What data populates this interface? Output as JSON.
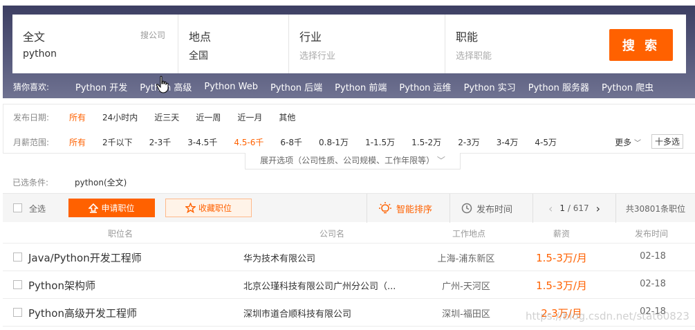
{
  "search": {
    "fields": [
      {
        "title": "全文",
        "value": "python",
        "hint": "搜公司"
      },
      {
        "title": "地点",
        "value": "全国"
      },
      {
        "title": "行业",
        "placeholder": "选择行业"
      },
      {
        "title": "职能",
        "placeholder": "选择职能"
      }
    ],
    "button_label": "搜 索",
    "guess_label": "猜你喜欢:",
    "guess_items": [
      "Python 开发",
      "Python 高级",
      "Python Web",
      "Python 后端",
      "Python 前端",
      "Python 运维",
      "Python 实习",
      "Python 服务器",
      "Python 爬虫"
    ]
  },
  "filters": {
    "date": {
      "label": "发布日期:",
      "options": [
        "所有",
        "24小时内",
        "近三天",
        "近一周",
        "近一月",
        "其他"
      ],
      "active": 0
    },
    "salary": {
      "label": "月薪范围:",
      "options": [
        "所有",
        "2千以下",
        "2-3千",
        "3-4.5千",
        "4.5-6千",
        "6-8千",
        "0.8-1万",
        "1-1.5万",
        "1.5-2万",
        "2-3万",
        "3-4万",
        "4-5万"
      ],
      "active": [
        0,
        4
      ]
    },
    "more_label": "更多",
    "multi_label": "十多选",
    "expand_label": "展开选项（公司性质、公司规模、工作年限等）",
    "selected_label": "已选条件:",
    "selected_value": "python(全文)"
  },
  "toolbar": {
    "select_all": "全选",
    "apply": "申请职位",
    "favorite": "收藏职位",
    "sort_smart": "智能排序",
    "sort_time": "发布时间",
    "page": "1",
    "page_total": "/ 617",
    "total": "共30801条职位"
  },
  "table": {
    "headers": [
      "职位名",
      "公司名",
      "工作地点",
      "薪资",
      "发布时间"
    ],
    "rows": [
      {
        "title": "Java/Python开发工程师",
        "company": "华为技术有限公司",
        "location": "上海-浦东新区",
        "salary": "1.5-3万/月",
        "date": "02-18"
      },
      {
        "title": "Python架构师",
        "company": "北京公瑾科技有限公司广州分公司（...",
        "location": "广州-天河区",
        "salary": "1.5-3万/月",
        "date": "02-18"
      },
      {
        "title": "Python高级开发工程师",
        "company": "深圳市道合顺科技有限公司",
        "location": "深圳-福田区",
        "salary": "2-3万/月",
        "date": "02-18"
      }
    ]
  },
  "watermark": "https://blog.csdn.net/stat60823",
  "colors": {
    "accent": "#ff6100"
  }
}
